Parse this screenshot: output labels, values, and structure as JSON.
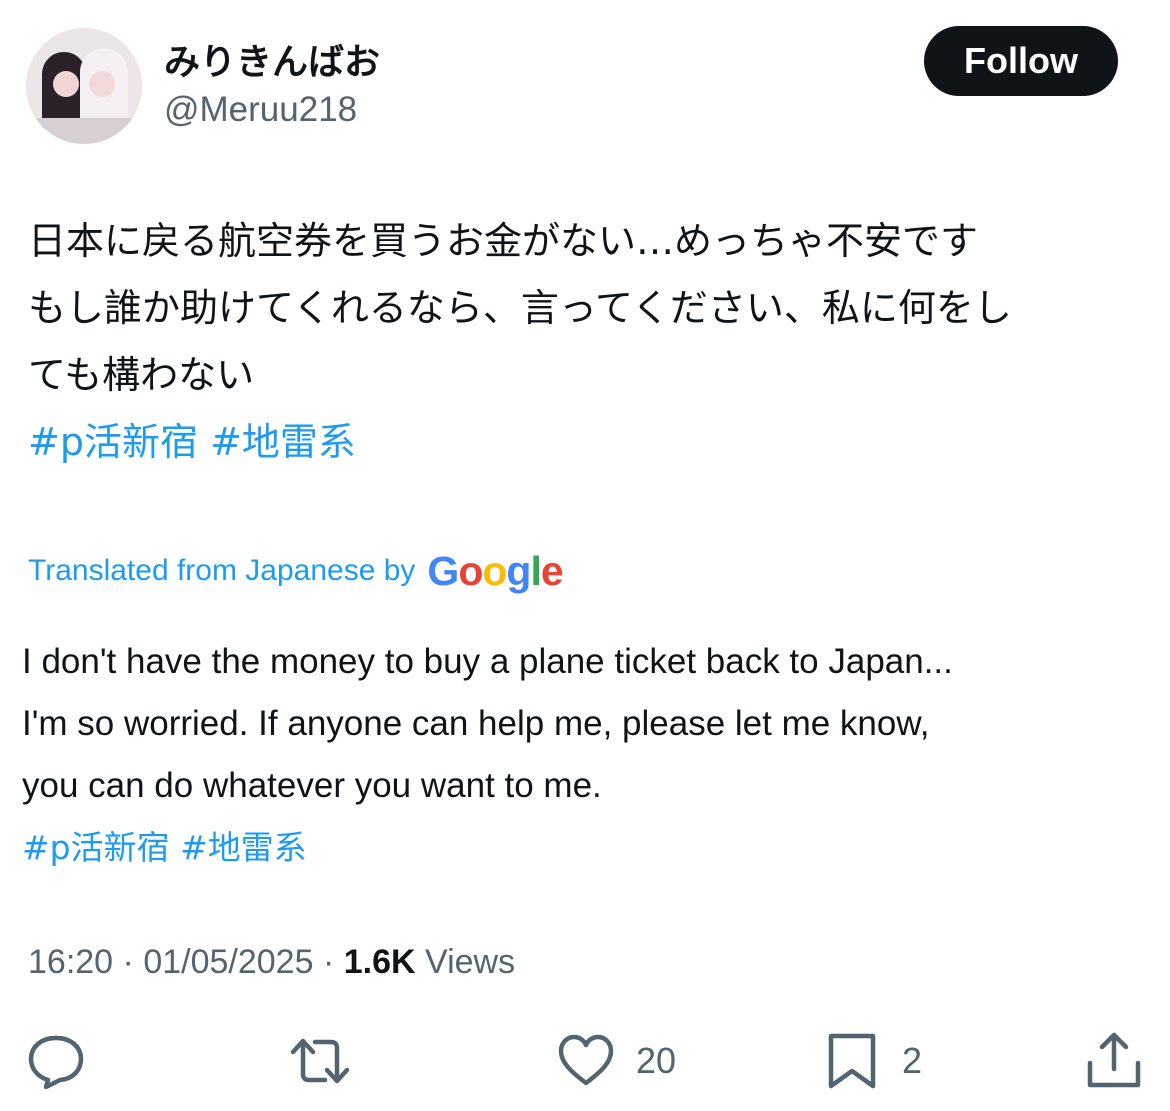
{
  "author": {
    "display_name": "みりきんばお",
    "handle": "@Meruu218",
    "avatar_icon": "avatar-photo"
  },
  "follow_label": "Follow",
  "tweet": {
    "original_lines": [
      "日本に戻る航空券を買うお金がない…めっちゃ不安です",
      "もし誰か助けてくれるなら、言ってください、私に何をし",
      "ても構わない"
    ],
    "hashtags": [
      "#p活新宿",
      "#地雷系"
    ],
    "translated_label": "Translated from Japanese by",
    "translator_brand": "Google",
    "translation_lines": [
      "I don't have the money to buy a plane ticket back to Japan...",
      "I'm so worried. If anyone can help me, please let me know,",
      "you can do whatever you want to me."
    ]
  },
  "meta": {
    "time": "16:20",
    "separator": "·",
    "date": "01/05/2025",
    "views_count": "1.6K",
    "views_label": "Views"
  },
  "actions": {
    "reply": {
      "icon": "reply-icon",
      "count": ""
    },
    "retweet": {
      "icon": "retweet-icon",
      "count": ""
    },
    "like": {
      "icon": "heart-icon",
      "count": "20"
    },
    "bookmark": {
      "icon": "bookmark-icon",
      "count": "2"
    },
    "share": {
      "icon": "share-icon",
      "count": ""
    }
  },
  "colors": {
    "link": "#1d9bf0",
    "secondary_text": "#536471",
    "primary_text": "#0f1419",
    "follow_bg": "#0f1419",
    "google_blue": "#4285f4",
    "google_red": "#ea4335",
    "google_yellow": "#fbbc05",
    "google_green": "#34a853"
  }
}
